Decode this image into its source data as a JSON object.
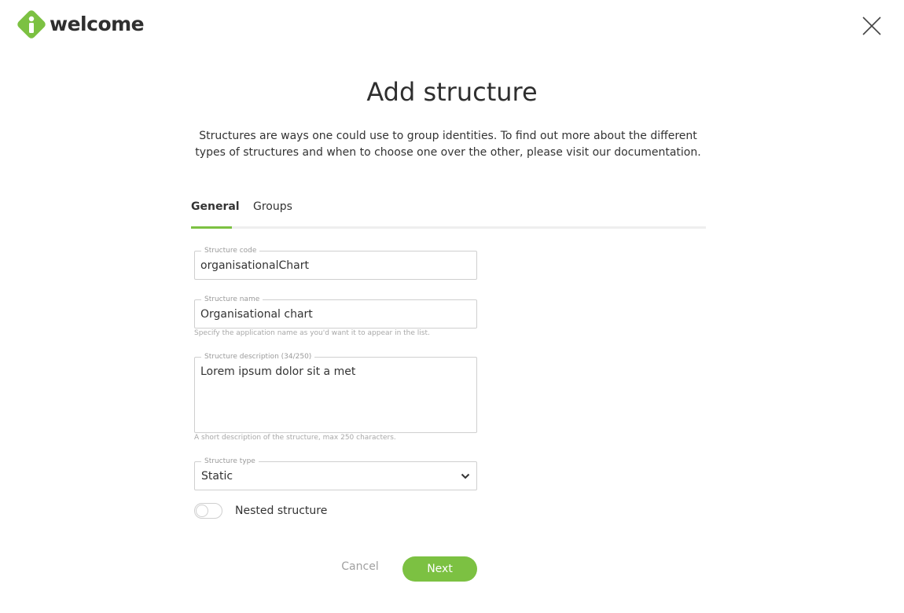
{
  "brand": {
    "name": "welcome",
    "logo_icon": "welcome-logo-icon",
    "accent_color": "#7cc142"
  },
  "header": {
    "close_icon": "close-icon"
  },
  "page": {
    "title": "Add structure",
    "intro": "Structures are ways one could use to group identities. To find out more about the different types of structures and when to choose one over the other, please visit our documentation."
  },
  "tabs": [
    {
      "label": "General",
      "active": true
    },
    {
      "label": "Groups",
      "active": false
    }
  ],
  "form": {
    "structure_code": {
      "label": "Structure code",
      "value": "organisationalChart"
    },
    "structure_name": {
      "label": "Structure name",
      "value": "Organisational chart",
      "helper": "Specify the application name as you'd want it to appear in the list."
    },
    "structure_description": {
      "label": "Structure description (34/250)",
      "value": "Lorem ipsum dolor sit a met",
      "helper": "A short description of the structure, max 250 characters."
    },
    "structure_type": {
      "label": "Structure type",
      "value": "Static",
      "icon": "chevron-down-icon"
    },
    "nested_structure": {
      "label": "Nested structure",
      "enabled": false
    }
  },
  "actions": {
    "cancel_label": "Cancel",
    "next_label": "Next"
  }
}
